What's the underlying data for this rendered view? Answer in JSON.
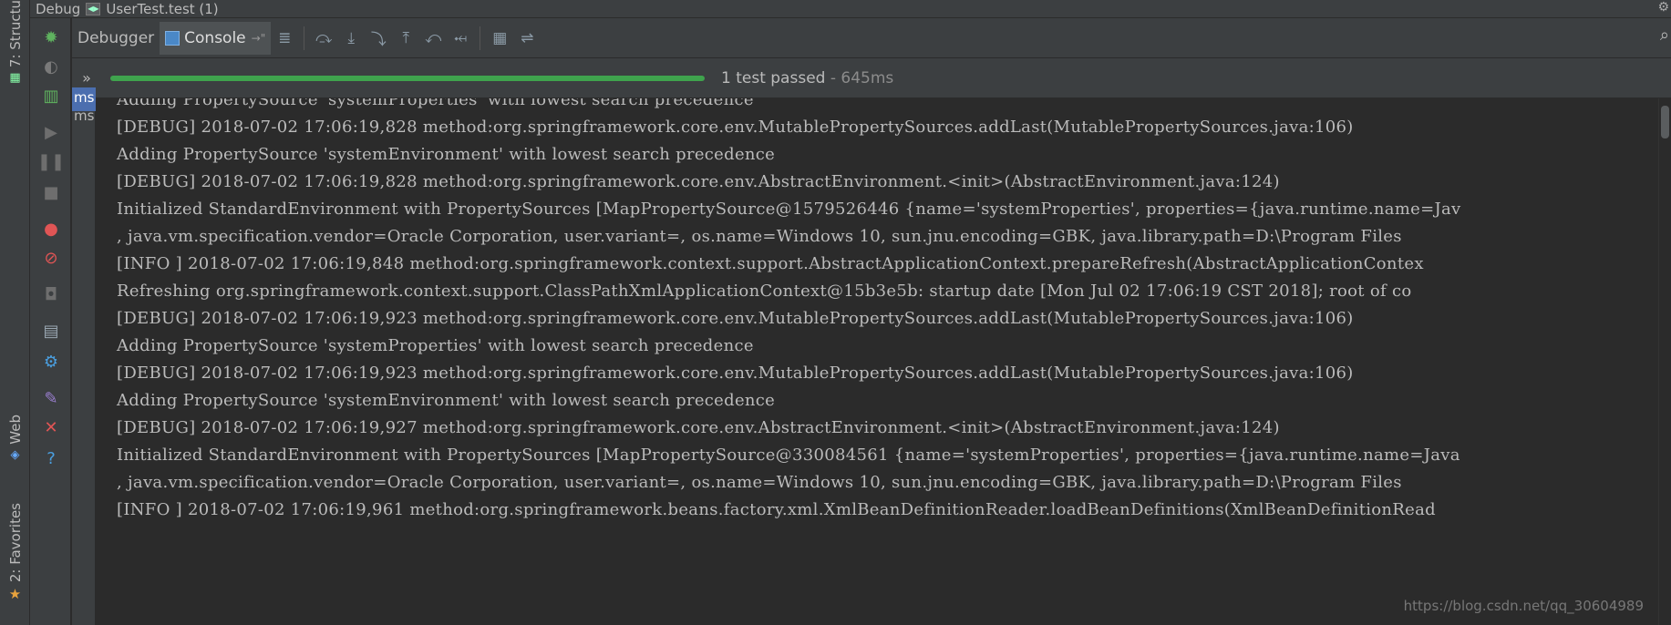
{
  "window": {
    "panel_title": "Debug",
    "run_config": "UserTest.test (1)"
  },
  "left_strip": {
    "structure_label": "7: Structu",
    "web_label": "Web",
    "favorites_label": "2: Favorites"
  },
  "tabs": [
    {
      "label": "Debugger"
    },
    {
      "label": "Console"
    }
  ],
  "tab_pin": "→\"",
  "test_status": {
    "summary": "1 test passed",
    "duration": " - 645ms",
    "progress": 1.0,
    "progress_color": "#3fa34d"
  },
  "test_tree": {
    "items": [
      {
        "label": "ms"
      },
      {
        "label": "ms"
      }
    ]
  },
  "console": {
    "lines": [
      "Adding PropertySource 'systemProperties' with lowest search precedence",
      "[DEBUG] 2018-07-02 17:06:19,828 method:org.springframework.core.env.MutablePropertySources.addLast(MutablePropertySources.java:106)",
      "Adding PropertySource 'systemEnvironment' with lowest search precedence",
      "[DEBUG] 2018-07-02 17:06:19,828 method:org.springframework.core.env.AbstractEnvironment.<init>(AbstractEnvironment.java:124)",
      "Initialized StandardEnvironment with PropertySources [MapPropertySource@1579526446 {name='systemProperties', properties={java.runtime.name=Jav",
      ", java.vm.specification.vendor=Oracle Corporation, user.variant=, os.name=Windows 10, sun.jnu.encoding=GBK, java.library.path=D:\\Program Files",
      "[INFO ] 2018-07-02 17:06:19,848 method:org.springframework.context.support.AbstractApplicationContext.prepareRefresh(AbstractApplicationContex",
      "Refreshing org.springframework.context.support.ClassPathXmlApplicationContext@15b3e5b: startup date [Mon Jul 02 17:06:19 CST 2018]; root of co",
      "[DEBUG] 2018-07-02 17:06:19,923 method:org.springframework.core.env.MutablePropertySources.addLast(MutablePropertySources.java:106)",
      "Adding PropertySource 'systemProperties' with lowest search precedence",
      "[DEBUG] 2018-07-02 17:06:19,923 method:org.springframework.core.env.MutablePropertySources.addLast(MutablePropertySources.java:106)",
      "Adding PropertySource 'systemEnvironment' with lowest search precedence",
      "[DEBUG] 2018-07-02 17:06:19,927 method:org.springframework.core.env.AbstractEnvironment.<init>(AbstractEnvironment.java:124)",
      "Initialized StandardEnvironment with PropertySources [MapPropertySource@330084561 {name='systemProperties', properties={java.runtime.name=Java",
      ", java.vm.specification.vendor=Oracle Corporation, user.variant=, os.name=Windows 10, sun.jnu.encoding=GBK, java.library.path=D:\\Program Files",
      "[INFO ] 2018-07-02 17:06:19,961 method:org.springframework.beans.factory.xml.XmlBeanDefinitionReader.loadBeanDefinitions(XmlBeanDefinitionRead"
    ]
  },
  "watermark": "https://blog.csdn.net/qq_30604989"
}
